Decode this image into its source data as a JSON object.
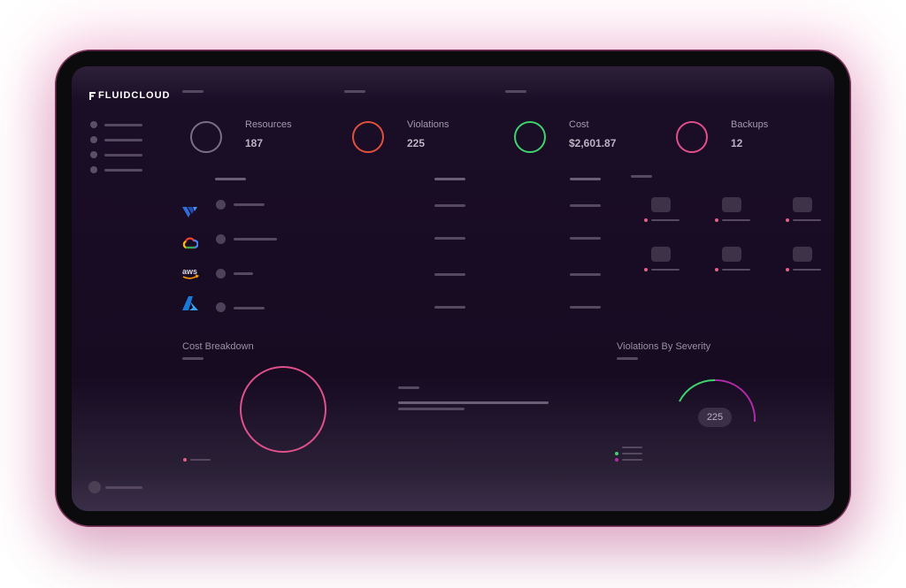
{
  "app": {
    "name": "FLUIDCLOUD"
  },
  "stats": [
    {
      "label": "Resources",
      "value": "187",
      "ring_color": "#7a6f82",
      "icon": "resources-ring-icon"
    },
    {
      "label": "Violations",
      "value": "225",
      "ring_color": "#e0503f",
      "icon": "violations-ring-icon"
    },
    {
      "label": "Cost",
      "value": "$2,601.87",
      "ring_color": "#3ed36c",
      "icon": "cost-ring-icon"
    },
    {
      "label": "Backups",
      "value": "12",
      "ring_color": "#e0508a",
      "icon": "backups-ring-icon"
    }
  ],
  "providers": [
    {
      "name": "vultr",
      "icon": "vultr-icon"
    },
    {
      "name": "google-cloud",
      "icon": "google-cloud-icon"
    },
    {
      "name": "aws",
      "icon": "aws-icon",
      "label": "aws"
    },
    {
      "name": "azure",
      "icon": "azure-icon"
    }
  ],
  "sections": {
    "cost_breakdown": {
      "title": "Cost Breakdown"
    },
    "violations_by_severity": {
      "title": "Violations By Severity",
      "total": "225"
    }
  },
  "colors": {
    "accent_pink": "#e0508a",
    "accent_green": "#3ed36c",
    "accent_purple": "#b02aa8",
    "background": "#170b22"
  }
}
